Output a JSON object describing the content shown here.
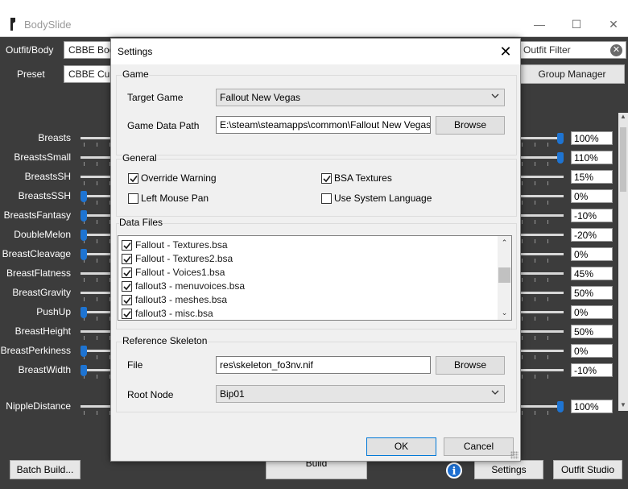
{
  "window": {
    "title": "BodySlide",
    "minimize_glyph": "—",
    "maximize_glyph": "☐",
    "close_glyph": "✕"
  },
  "main": {
    "outfit_body_label": "Outfit/Body",
    "outfit_body_value": "CBBE Body",
    "preset_label": "Preset",
    "preset_value": "CBBE Curvy",
    "outfit_filter_placeholder": "Outfit Filter",
    "filter_clear_glyph": "✕",
    "group_manager_label": "Group Manager",
    "sliders": [
      {
        "label": "Breasts",
        "value": "100%",
        "level": 100
      },
      {
        "label": "BreastsSmall",
        "value": "110%",
        "level": 100
      },
      {
        "label": "BreastsSH",
        "value": "15%",
        "level": 15
      },
      {
        "label": "BreastsSSH",
        "value": "0%",
        "level": 0
      },
      {
        "label": "BreastsFantasy",
        "value": "-10%",
        "level": 0
      },
      {
        "label": "DoubleMelon",
        "value": "-20%",
        "level": 0
      },
      {
        "label": "BreastCleavage",
        "value": "0%",
        "level": 0
      },
      {
        "label": "BreastFlatness",
        "value": "45%",
        "level": 45
      },
      {
        "label": "BreastGravity",
        "value": "50%",
        "level": 50
      },
      {
        "label": "PushUp",
        "value": "0%",
        "level": 0
      },
      {
        "label": "BreastHeight",
        "value": "50%",
        "level": 50
      },
      {
        "label": "BreastPerkiness",
        "value": "0%",
        "level": 0
      },
      {
        "label": "BreastWidth",
        "value": "-10%",
        "level": 0
      },
      {
        "label": "NippleDistance",
        "value": "100%",
        "level": 100
      }
    ],
    "batch_build_label": "Batch Build...",
    "build_label": "Build",
    "settings_label": "Settings",
    "outfit_studio_label": "Outfit Studio",
    "info_glyph": "i"
  },
  "dialog": {
    "title": "Settings",
    "close_glyph": "✕",
    "game_group": {
      "title": "Game",
      "target_game_label": "Target Game",
      "target_game_value": "Fallout New Vegas",
      "game_data_path_label": "Game Data Path",
      "game_data_path_value": "E:\\steam\\steamapps\\common\\Fallout New Vegas\\Data\\",
      "browse_label": "Browse"
    },
    "general_group": {
      "title": "General",
      "override_warning": {
        "label": "Override Warning",
        "checked": true
      },
      "bsa_textures": {
        "label": "BSA Textures",
        "checked": true
      },
      "left_mouse_pan": {
        "label": "Left Mouse Pan",
        "checked": false
      },
      "use_system_language": {
        "label": "Use System Language",
        "checked": false
      }
    },
    "data_files_group": {
      "title": "Data Files",
      "files": [
        {
          "label": "Fallout - Textures.bsa",
          "checked": true
        },
        {
          "label": "Fallout - Textures2.bsa",
          "checked": true
        },
        {
          "label": "Fallout - Voices1.bsa",
          "checked": true
        },
        {
          "label": "fallout3 - menuvoices.bsa",
          "checked": true
        },
        {
          "label": "fallout3 - meshes.bsa",
          "checked": true
        },
        {
          "label": "fallout3 - misc.bsa",
          "checked": true
        }
      ]
    },
    "reference_skeleton_group": {
      "title": "Reference Skeleton",
      "file_label": "File",
      "file_value": "res\\skeleton_fo3nv.nif",
      "browse_label": "Browse",
      "root_node_label": "Root Node",
      "root_node_value": "Bip01"
    },
    "ok_label": "OK",
    "cancel_label": "Cancel"
  },
  "colors": {
    "background": "#3c3c3c",
    "accent": "#1e74d2",
    "dialog_bg": "#f0f0f0"
  }
}
